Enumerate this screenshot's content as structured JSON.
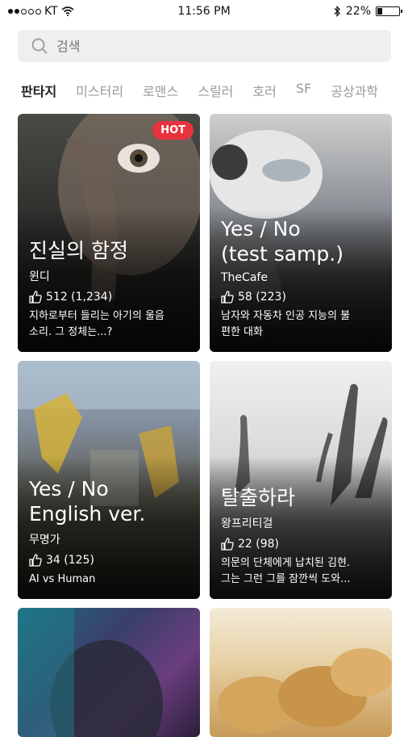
{
  "status_bar": {
    "carrier": "KT",
    "time": "11:56 PM",
    "battery_percent": "22%",
    "battery_level": 0.22,
    "signal_bars": 2,
    "icons": [
      "wifi-icon",
      "bluetooth-icon",
      "battery-icon"
    ]
  },
  "search": {
    "placeholder": "검색",
    "icon": "search-icon"
  },
  "tabs": [
    {
      "label": "판타지",
      "active": true
    },
    {
      "label": "미스터리",
      "active": false
    },
    {
      "label": "로맨스",
      "active": false
    },
    {
      "label": "스릴러",
      "active": false
    },
    {
      "label": "호러",
      "active": false
    },
    {
      "label": "SF",
      "active": false
    },
    {
      "label": "공상과학",
      "active": false
    }
  ],
  "cards": [
    {
      "badge": "HOT",
      "title": "진실의 함정",
      "author": "윈디",
      "likes": "512 (1,234)",
      "description": "지하로부터 들리는 아기의 울음\n소리. 그 정체는...?"
    },
    {
      "title": "Yes / No\n(test samp.)",
      "author": "TheCafe",
      "likes": "58 (223)",
      "description": "남자와 자동차 인공 지능의 불\n편한 대화"
    },
    {
      "title": "Yes / No\nEnglish ver.",
      "author": "무명가",
      "likes": "34 (125)",
      "description": "AI vs Human"
    },
    {
      "title": "탈출하라",
      "author": "왕프리티걸",
      "likes": "22 (98)",
      "description": "의문의 단체에게 납치된 김현.\n그는 그런 그를 잠깐씩 도와..."
    },
    {},
    {}
  ],
  "colors": {
    "hot_badge": "#e8333f",
    "tab_active": "#222222",
    "tab_inactive": "#9a9a9a",
    "search_bg": "#efefef"
  }
}
